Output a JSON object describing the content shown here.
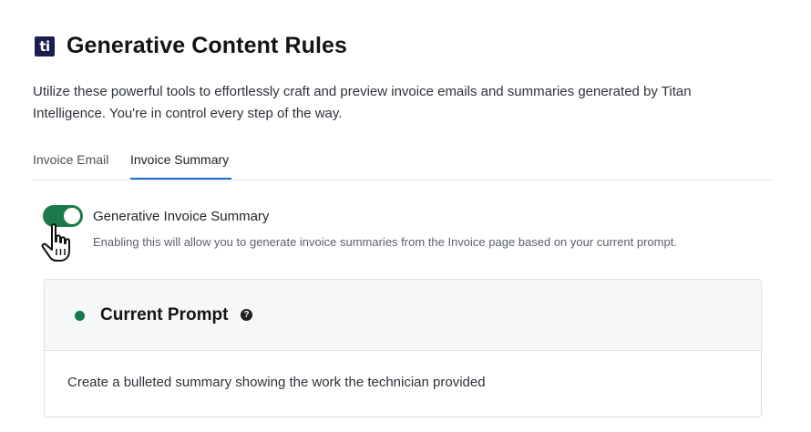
{
  "header": {
    "logo_text": "ti",
    "title": "Generative Content Rules"
  },
  "description": "Utilize these powerful tools to effortlessly craft and preview invoice emails and summaries generated by Titan Intelligence. You're in control every step of the way.",
  "tabs": [
    {
      "label": "Invoice Email",
      "active": false
    },
    {
      "label": "Invoice Summary",
      "active": true
    }
  ],
  "toggle": {
    "enabled": true,
    "label": "Generative Invoice Summary",
    "help": "Enabling this will allow you to generate invoice summaries from the Invoice page based on your current prompt."
  },
  "prompt_card": {
    "title": "Current Prompt",
    "help_icon": "?",
    "text": "Create a bulleted summary showing the work the technician provided"
  },
  "colors": {
    "accent_green": "#1b7a4a",
    "tab_underline": "#1f6fd1",
    "logo_bg": "#1c1c4e"
  }
}
